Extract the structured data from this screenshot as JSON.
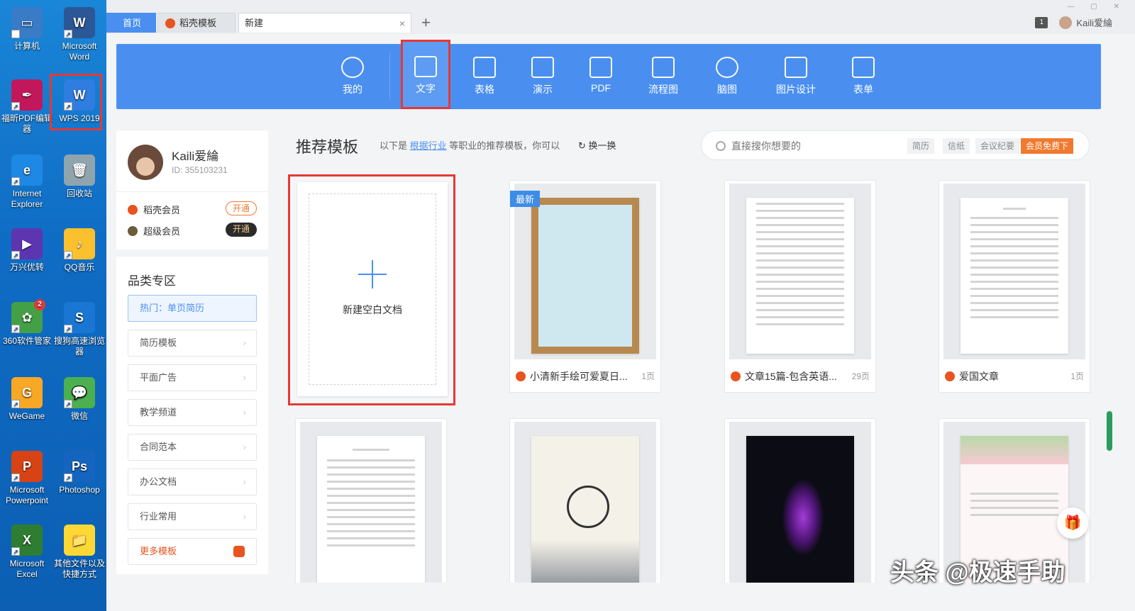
{
  "desktop": {
    "icons": [
      {
        "label": "计算机",
        "color": "#3a7bc8"
      },
      {
        "label": "Microsoft Word",
        "color": "#2b5797"
      },
      {
        "label": "福昕PDF编辑器",
        "color": "#c2185b"
      },
      {
        "label": "WPS 2019",
        "color": "#2f7de1"
      },
      {
        "label": "Internet Explorer",
        "color": "#1e88e5"
      },
      {
        "label": "回收站",
        "color": "#90a4ae"
      },
      {
        "label": "万兴优转",
        "color": "#5e35b1"
      },
      {
        "label": "QQ音乐",
        "color": "#fbc02d"
      },
      {
        "label": "360软件管家",
        "color": "#43a047",
        "badge": "2"
      },
      {
        "label": "搜狗高速浏览器",
        "color": "#1976d2"
      },
      {
        "label": "WeGame",
        "color": "#f9a825"
      },
      {
        "label": "微信",
        "color": "#4caf50"
      },
      {
        "label": "Microsoft Powerpoint",
        "color": "#d84315"
      },
      {
        "label": "Photoshop",
        "color": "#1565c0"
      },
      {
        "label": "Microsoft Excel",
        "color": "#2e7d32"
      },
      {
        "label": "其他文件以及快捷方式",
        "color": "#fdd835"
      }
    ]
  },
  "tabs": {
    "home": "首页",
    "docer": "稻壳模板",
    "new": "新建",
    "close": "×",
    "add": "+"
  },
  "user": {
    "name": "Kaili爱綸",
    "id": "ID: 355103231",
    "notif_count": "1"
  },
  "categories": [
    "我的",
    "文字",
    "表格",
    "演示",
    "PDF",
    "流程图",
    "脑图",
    "图片设计",
    "表单"
  ],
  "active_category": "文字",
  "membership": [
    {
      "label": "稻壳会员",
      "button": "开通",
      "color": "#e8531f"
    },
    {
      "label": "超级会员",
      "button": "开通",
      "color": "#6d5b3a"
    }
  ],
  "sidebar": {
    "title": "品类专区",
    "items": [
      "热门：单页简历",
      "简历模板",
      "平面广告",
      "教学频道",
      "合同范本",
      "办公文档",
      "行业常用",
      "更多模板"
    ]
  },
  "recommend": {
    "title": "推荐模板",
    "desc_pre": "以下是",
    "desc_link": "根据行业",
    "desc_post": "等职业的推荐模板，你可以",
    "refresh": "换一换"
  },
  "search": {
    "placeholder": "直接搜你想要的",
    "tags": [
      "简历",
      "信纸",
      "会议纪要"
    ],
    "vip_tag": "会员免费下"
  },
  "blank_doc": {
    "label": "新建空白文档"
  },
  "templates": [
    {
      "name": "小清新手绘可爱夏日...",
      "pages": "1页",
      "tag": "最新"
    },
    {
      "name": "文章15篇-包含英语...",
      "pages": "29页",
      "tag": ""
    },
    {
      "name": "爱国文章",
      "pages": "1页",
      "tag": ""
    },
    {
      "name": "",
      "pages": "",
      "tag": ""
    },
    {
      "name": "",
      "pages": "",
      "tag": ""
    },
    {
      "name": "",
      "pages": "",
      "tag": ""
    },
    {
      "name": "",
      "pages": "",
      "tag": ""
    }
  ],
  "watermark": "头条 @极速手助"
}
